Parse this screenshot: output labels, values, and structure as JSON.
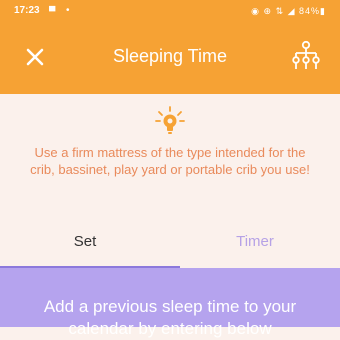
{
  "status_bar": {
    "time": "17:23",
    "notification": "▀",
    "dot": "•",
    "right": "◉ ⊕ ⇅ ◢ 84%▮"
  },
  "header": {
    "title": "Sleeping Time",
    "background_color": "#f6a234",
    "close_icon": "close-icon",
    "family_tree_icon": "family-tree-icon"
  },
  "tip": {
    "icon": "lightbulb-icon",
    "text": "Use a firm mattress of the type intended for the crib, bassinet, play yard or portable crib you use!",
    "text_color": "#e98a5b"
  },
  "tabs": {
    "set_label": "Set",
    "timer_label": "Timer",
    "active": "Set",
    "indicator_color": "#8c79dc"
  },
  "panel": {
    "text": "Add a previous sleep time to your calendar by entering below",
    "background_color": "#b5a3ee"
  }
}
